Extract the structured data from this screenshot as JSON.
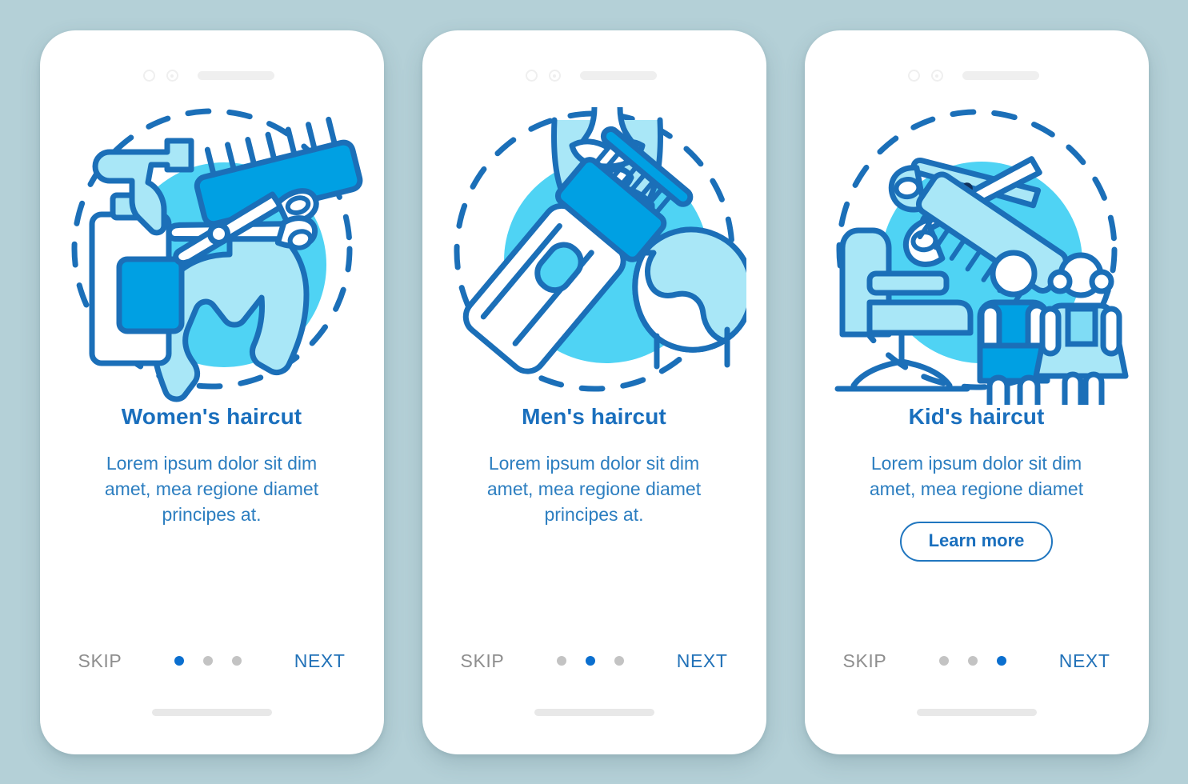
{
  "meta": {
    "background_color": "#b4d0d7",
    "accent_blue": "#1a6fbd",
    "body_blue": "#2c7ec0",
    "cyan": "#4fd3f4",
    "light_cyan": "#a9e7f7",
    "strong_blue": "#00a0e3",
    "outline_blue": "#1b6fb8",
    "skip_gray": "#8e8e8e",
    "dot_inactive": "#c3c3c3",
    "dot_active": "#0b6fcf"
  },
  "screens": [
    {
      "id": "womens-haircut",
      "title": "Women's haircut",
      "description": "Lorem ipsum dolor sit dim amet, mea regione diamet principes at.",
      "illustration": "spray-bottle-comb-scissors-hair-icon",
      "has_learn_more": false,
      "learn_more_label": "",
      "skip_label": "SKIP",
      "next_label": "NEXT",
      "dots": {
        "count": 3,
        "active_index": 0
      }
    },
    {
      "id": "mens-haircut",
      "title": "Men's haircut",
      "description": "Lorem ipsum dolor sit dim amet, mea regione diamet principes at.",
      "illustration": "hair-clipper-bearded-man-icon",
      "has_learn_more": false,
      "learn_more_label": "",
      "skip_label": "SKIP",
      "next_label": "NEXT",
      "dots": {
        "count": 3,
        "active_index": 1
      }
    },
    {
      "id": "kids-haircut",
      "title": "Kid's haircut",
      "description": "Lorem ipsum dolor sit dim amet, mea regione diamet",
      "illustration": "barber-chair-scissors-comb-children-icon",
      "has_learn_more": true,
      "learn_more_label": "Learn more",
      "skip_label": "SKIP",
      "next_label": "NEXT",
      "dots": {
        "count": 3,
        "active_index": 2
      }
    }
  ]
}
